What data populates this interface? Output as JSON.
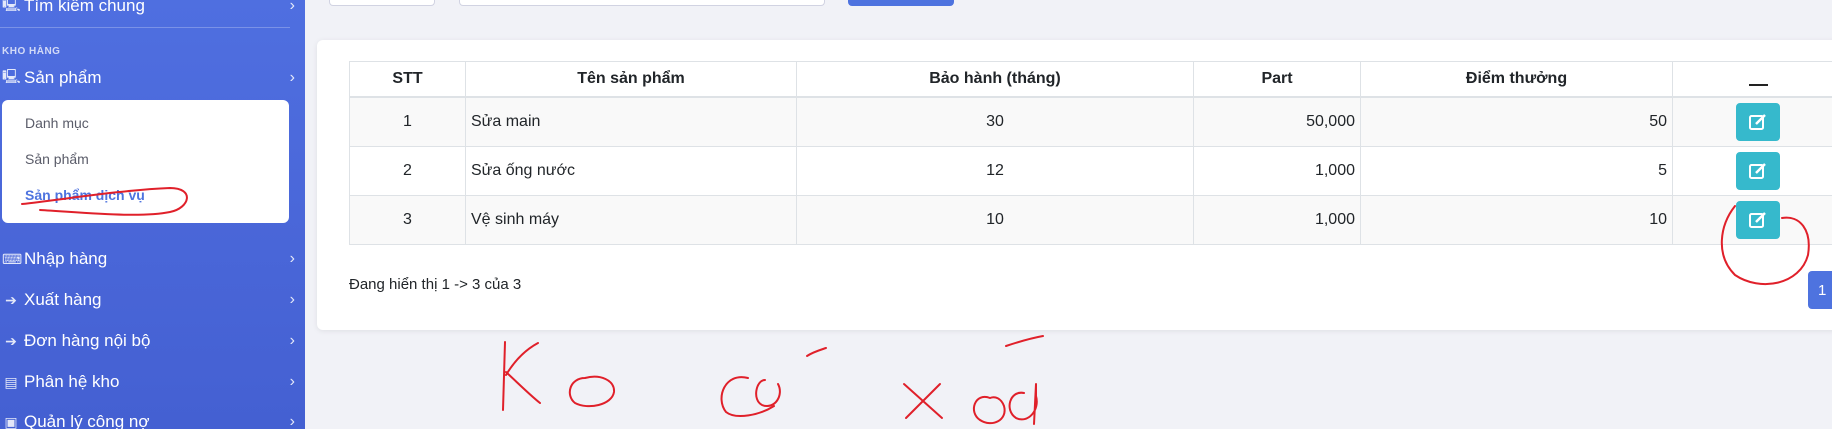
{
  "sidebar": {
    "items_top": [
      {
        "label": "Tìm kiếm chung",
        "icon": "laptop-icon"
      }
    ],
    "section_title": "KHO HÀNG",
    "products": {
      "label": "Sản phẩm",
      "icon": "laptop-icon"
    },
    "submenu": [
      {
        "label": "Danh mục"
      },
      {
        "label": "Sản phẩm"
      },
      {
        "label": "Sản phẩm dịch vụ",
        "active": true
      }
    ],
    "items": [
      {
        "label": "Nhập hàng",
        "icon": "keyboard-icon"
      },
      {
        "label": "Xuất hàng",
        "icon": "arrow-right-icon"
      },
      {
        "label": "Đơn hàng nội bộ",
        "icon": "arrow-right-icon"
      },
      {
        "label": "Phân hệ kho",
        "icon": "warehouse-icon"
      },
      {
        "label": "Quản lý công nợ",
        "icon": "money-icon"
      }
    ]
  },
  "table": {
    "headers": [
      "STT",
      "Tên sản phẩm",
      "Bảo hành (tháng)",
      "Part",
      "Điểm thưởng",
      "—"
    ],
    "rows": [
      {
        "stt": "1",
        "name": "Sửa main",
        "warranty": "30",
        "part": "50,000",
        "points": "50"
      },
      {
        "stt": "2",
        "name": "Sửa ống nước",
        "warranty": "12",
        "part": "1,000",
        "points": "5"
      },
      {
        "stt": "3",
        "name": "Vệ sinh máy",
        "warranty": "10",
        "part": "1,000",
        "points": "10"
      }
    ]
  },
  "summary": "Đang hiển thị 1 -> 3 của 3",
  "pagination": {
    "current": "1"
  },
  "annotation": {
    "handwritten_text": "Ko có xóa",
    "color": "#e0202a"
  },
  "colors": {
    "sidebar": "#4e73df",
    "edit_button": "#36b9cc",
    "active_link": "#4e73df"
  }
}
